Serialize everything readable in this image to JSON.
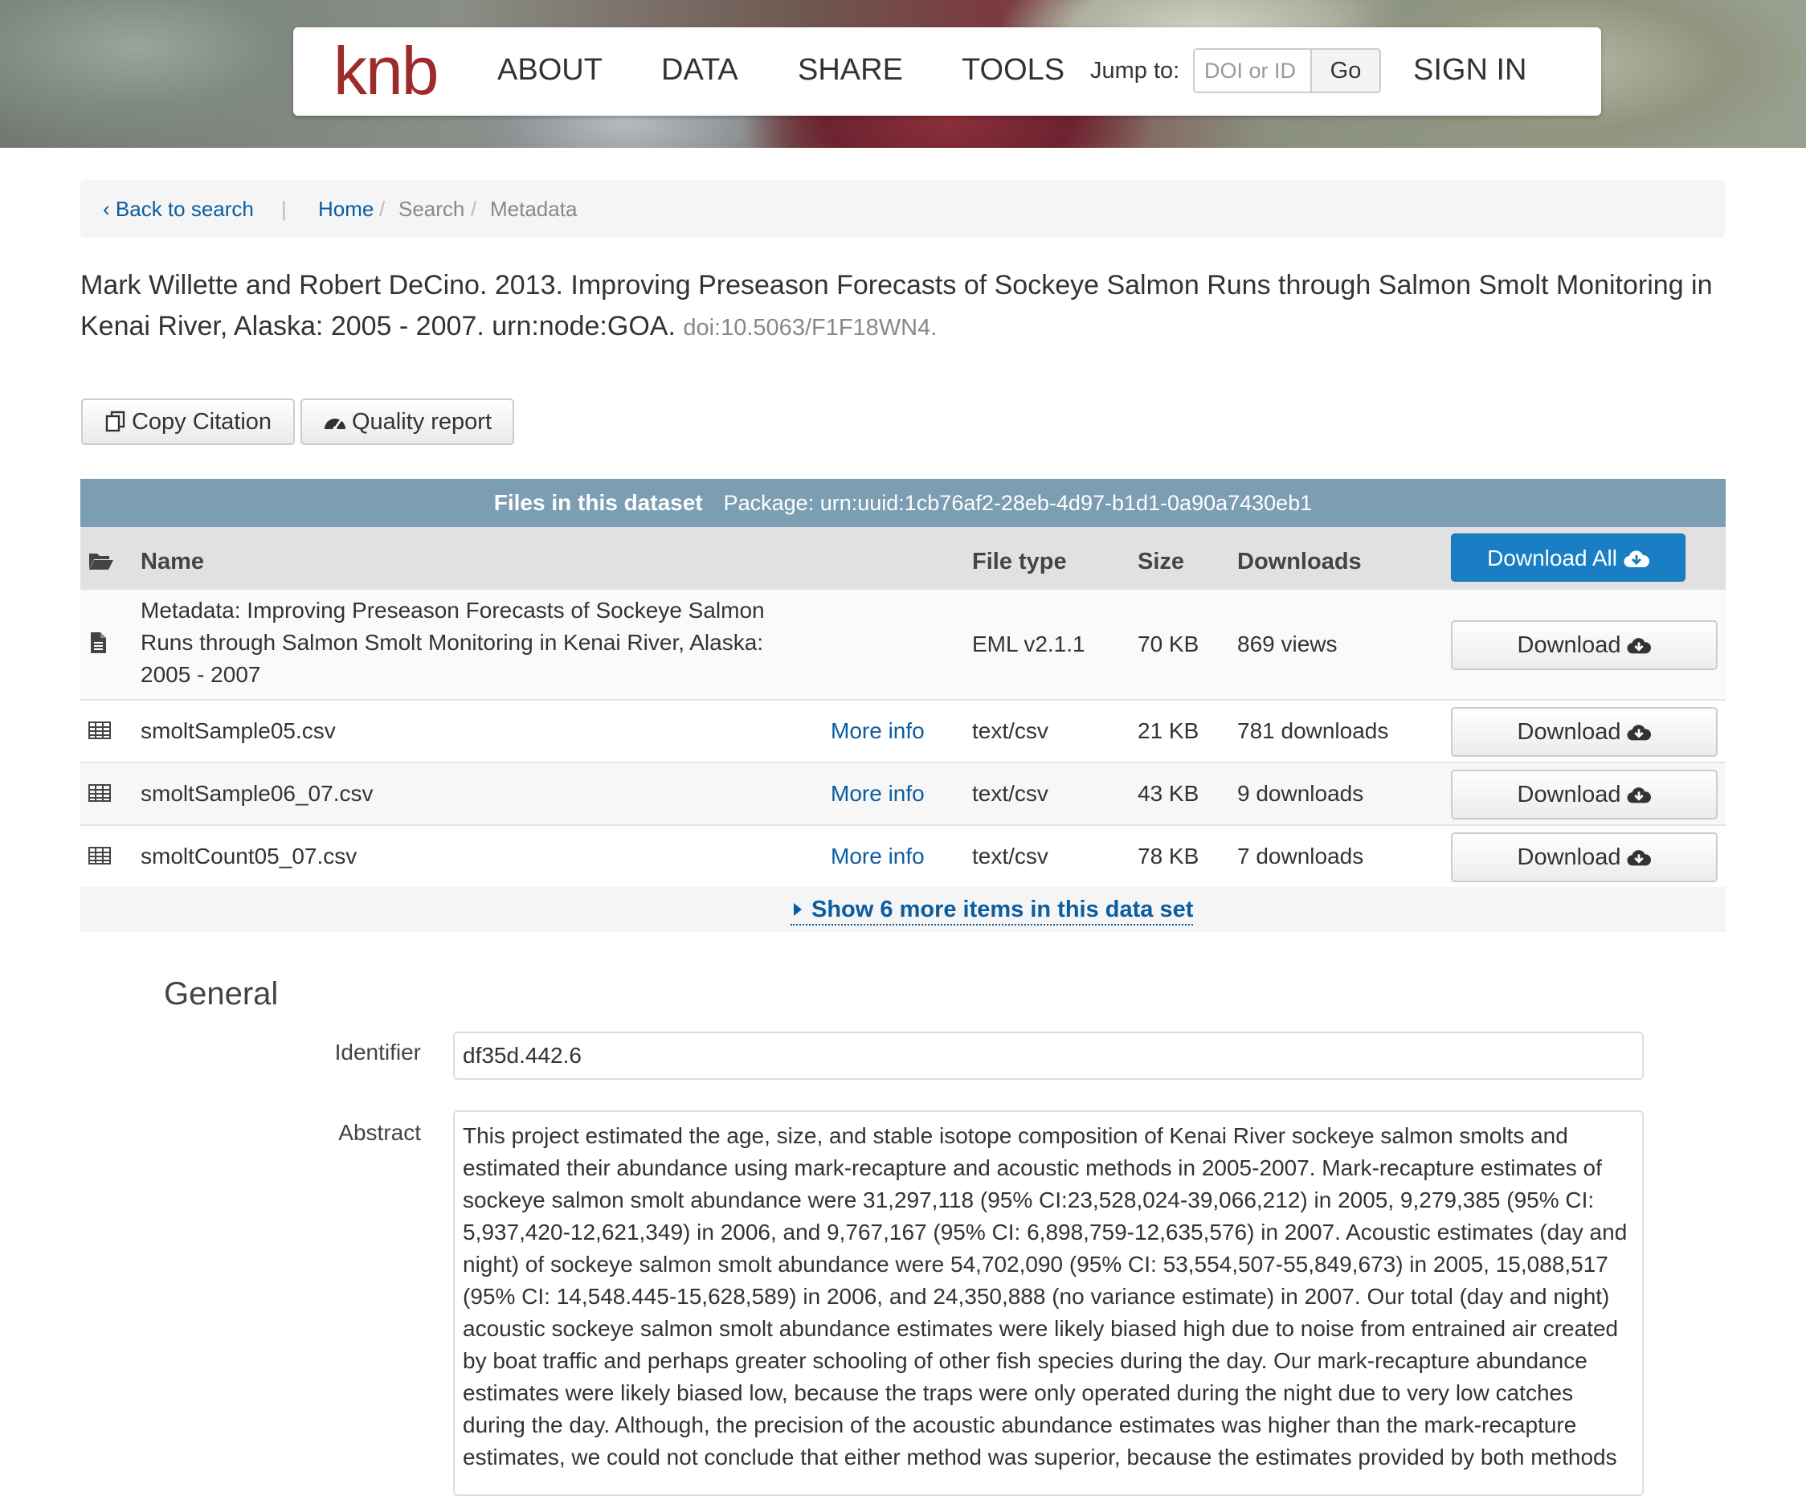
{
  "header": {
    "logo": "knb",
    "nav": [
      "ABOUT",
      "DATA",
      "SHARE",
      "TOOLS"
    ],
    "jump_label": "Jump to:",
    "jump_placeholder": "DOI or ID",
    "go_label": "Go",
    "sign_in": "SIGN IN"
  },
  "breadcrumb": {
    "back": "Back to search",
    "separator": "|",
    "home": "Home",
    "search": "Search",
    "current": "Metadata",
    "slash": "/"
  },
  "citation": {
    "text": "Mark Willette and Robert DeCino. 2013. Improving Preseason Forecasts of Sockeye Salmon Runs through Salmon Smolt Monitoring in Kenai River, Alaska: 2005 - 2007. urn:node:GOA.",
    "doi": "doi:10.5063/F1F18WN4."
  },
  "actions": {
    "copy_citation": "Copy Citation",
    "quality_report": "Quality report"
  },
  "files": {
    "title": "Files in this dataset",
    "package": "Package: urn:uuid:1cb76af2-28eb-4d97-b1d1-0a90a7430eb1",
    "columns": {
      "name": "Name",
      "file_type": "File type",
      "size": "Size",
      "downloads": "Downloads"
    },
    "download_all": "Download All",
    "download_label": "Download",
    "more_info": "More info",
    "rows": [
      {
        "name": "Metadata: Improving Preseason Forecasts of Sockeye Salmon Runs through Salmon Smolt Monitoring in Kenai River, Alaska: 2005 - 2007",
        "type": "EML v2.1.1",
        "size": "70 KB",
        "downloads": "869 views"
      },
      {
        "name": "smoltSample05.csv",
        "type": "text/csv",
        "size": "21 KB",
        "downloads": "781 downloads"
      },
      {
        "name": "smoltSample06_07.csv",
        "type": "text/csv",
        "size": "43 KB",
        "downloads": "9 downloads"
      },
      {
        "name": "smoltCount05_07.csv",
        "type": "text/csv",
        "size": "78 KB",
        "downloads": "7 downloads"
      }
    ],
    "show_more": "Show 6 more items in this data set"
  },
  "general": {
    "title": "General",
    "identifier_label": "Identifier",
    "identifier": "df35d.442.6",
    "abstract_label": "Abstract",
    "abstract": "This project estimated the age, size, and stable isotope composition of Kenai River sockeye salmon smolts and estimated their abundance using mark-recapture and acoustic methods in 2005-2007. Mark-recapture estimates of sockeye salmon smolt abundance were 31,297,118 (95% CI:23,528,024-39,066,212) in 2005, 9,279,385 (95% CI: 5,937,420-12,621,349) in 2006, and 9,767,167 (95% CI: 6,898,759-12,635,576) in 2007. Acoustic estimates (day and night) of sockeye salmon smolt abundance were 54,702,090 (95% CI: 53,554,507-55,849,673) in 2005, 15,088,517 (95% CI: 14,548.445-15,628,589) in 2006, and 24,350,888 (no variance estimate) in 2007. Our total (day and night) acoustic sockeye salmon smolt abundance estimates were likely biased high due to noise from entrained air created by boat traffic and perhaps greater schooling of other fish species during the day. Our mark-recapture abundance estimates were likely biased low, because the traps were only operated during the night due to very low catches during the day. Although, the precision of the acoustic abundance estimates was higher than the mark-recapture estimates, we could not conclude that either method was superior, because the estimates provided by both methods"
  },
  "colors": {
    "brand": "#9e2a2b",
    "link": "#0b5da2",
    "primary_button": "#1a7ec4",
    "files_header": "#7b9eb3"
  }
}
